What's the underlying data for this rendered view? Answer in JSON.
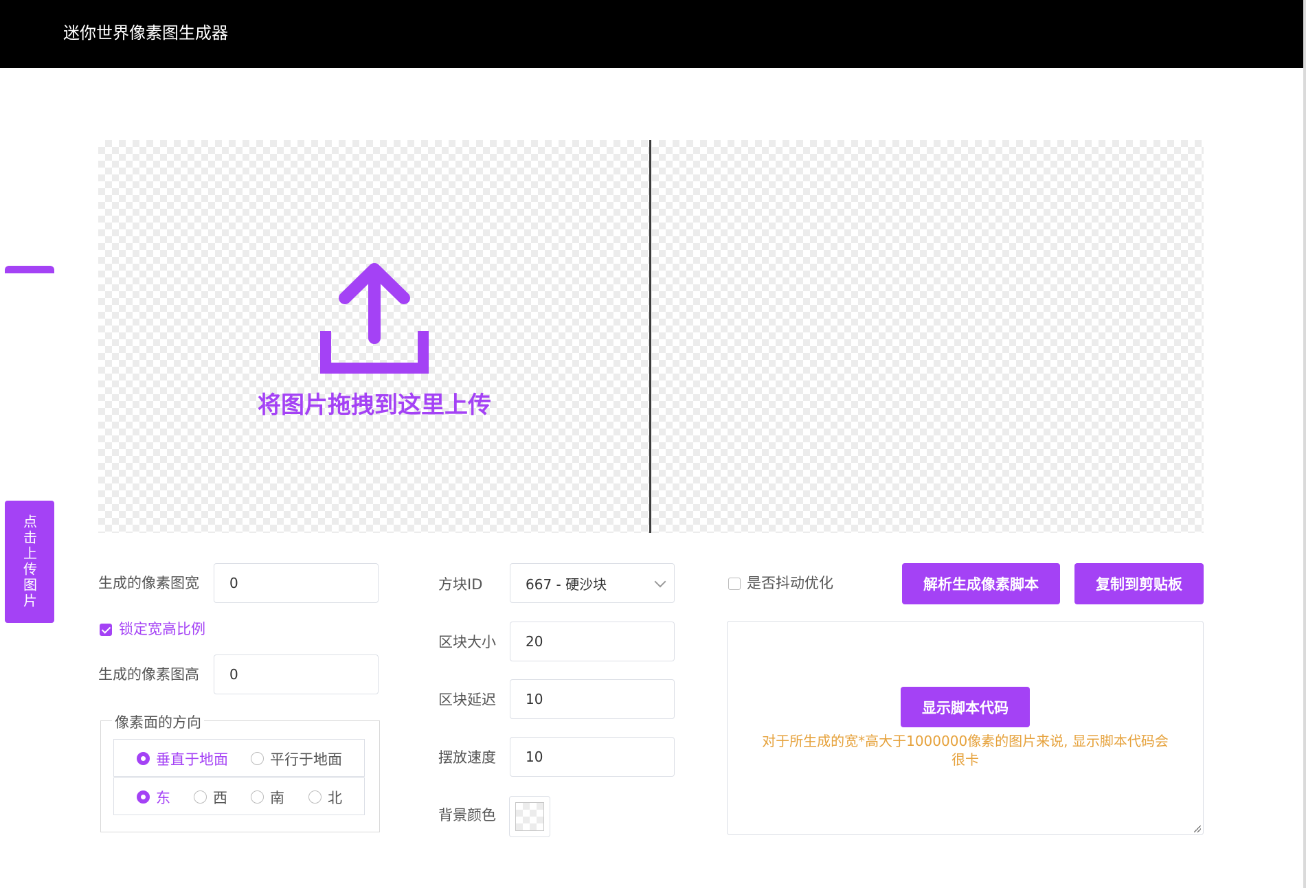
{
  "app": {
    "title": "迷你世界像素图生成器"
  },
  "sidebar": {
    "upload_label": "点击上传图片"
  },
  "dropzone": {
    "hint": "将图片拖拽到这里上传"
  },
  "size_panel": {
    "width_label": "生成的像素图宽",
    "width_value": "0",
    "lock_label": "锁定宽高比例",
    "lock_checked": true,
    "height_label": "生成的像素图高",
    "height_value": "0",
    "direction_legend": "像素面的方向",
    "plane_options": [
      {
        "label": "垂直于地面",
        "selected": true
      },
      {
        "label": "平行于地面",
        "selected": false
      }
    ],
    "facing_options": [
      {
        "label": "东",
        "selected": true
      },
      {
        "label": "西",
        "selected": false
      },
      {
        "label": "南",
        "selected": false
      },
      {
        "label": "北",
        "selected": false
      }
    ]
  },
  "block_panel": {
    "block_id_label": "方块ID",
    "block_id_value": "667 - 硬沙块",
    "chunk_size_label": "区块大小",
    "chunk_size_value": "20",
    "chunk_delay_label": "区块延迟",
    "chunk_delay_value": "10",
    "place_speed_label": "摆放速度",
    "place_speed_value": "10",
    "bg_color_label": "背景颜色"
  },
  "script_panel": {
    "dither_label": "是否抖动优化",
    "dither_checked": false,
    "parse_button": "解析生成像素脚本",
    "copy_button": "复制到剪贴板",
    "show_code_button": "显示脚本代码",
    "warning": "对于所生成的宽*高大于1000000像素的图片来说, 显示脚本代码会很卡"
  },
  "colors": {
    "accent": "#a442f5",
    "topbar": "#000000",
    "warning": "#e6a23c"
  }
}
